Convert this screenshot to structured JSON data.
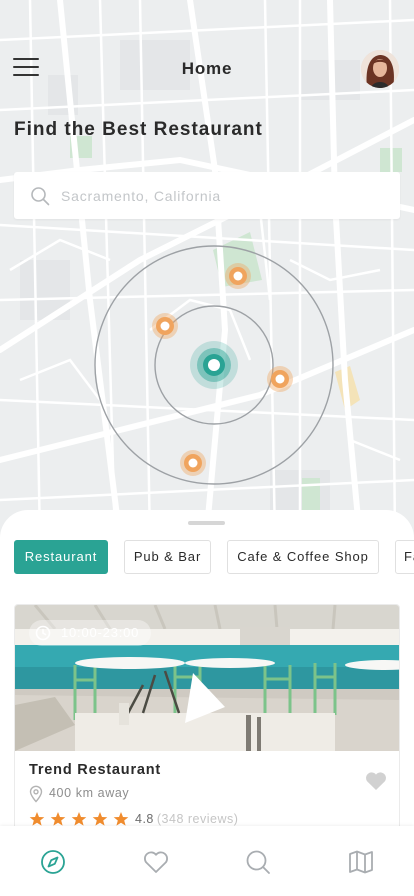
{
  "header": {
    "title": "Home",
    "menu_icon": "hamburger-menu-icon",
    "avatar": "user-avatar"
  },
  "headline": "Find the Best Restaurant",
  "search": {
    "icon": "search-icon",
    "value": "",
    "placeholder": "Sacramento, California"
  },
  "map": {
    "accent": "#2aa394",
    "marker_color": "#f0a45e",
    "current_location_icon": "current-location-icon",
    "marker_icon": "restaurant-marker-icon"
  },
  "categories": [
    {
      "label": "Restaurant",
      "active": true
    },
    {
      "label": "Pub & Bar",
      "active": false
    },
    {
      "label": "Cafe & Coffee Shop",
      "active": false
    },
    {
      "label": "Fast Food",
      "active": false
    }
  ],
  "card": {
    "hours": "10:00-23:00",
    "name": "Trend Restaurant",
    "distance": "400 km away",
    "rating": "4.8",
    "reviews": "(348 reviews)",
    "stars": 5,
    "star_color": "#f08c2e",
    "favorite_icon": "heart-icon"
  },
  "tabs": [
    {
      "name": "explore",
      "icon": "compass-icon",
      "active": true
    },
    {
      "name": "favorites",
      "icon": "heart-icon",
      "active": false
    },
    {
      "name": "search",
      "icon": "search-icon",
      "active": false
    },
    {
      "name": "map",
      "icon": "map-icon",
      "active": false
    }
  ],
  "colors": {
    "accent": "#2aa394",
    "text": "#2a2a2a",
    "muted": "#8d8d8d"
  }
}
